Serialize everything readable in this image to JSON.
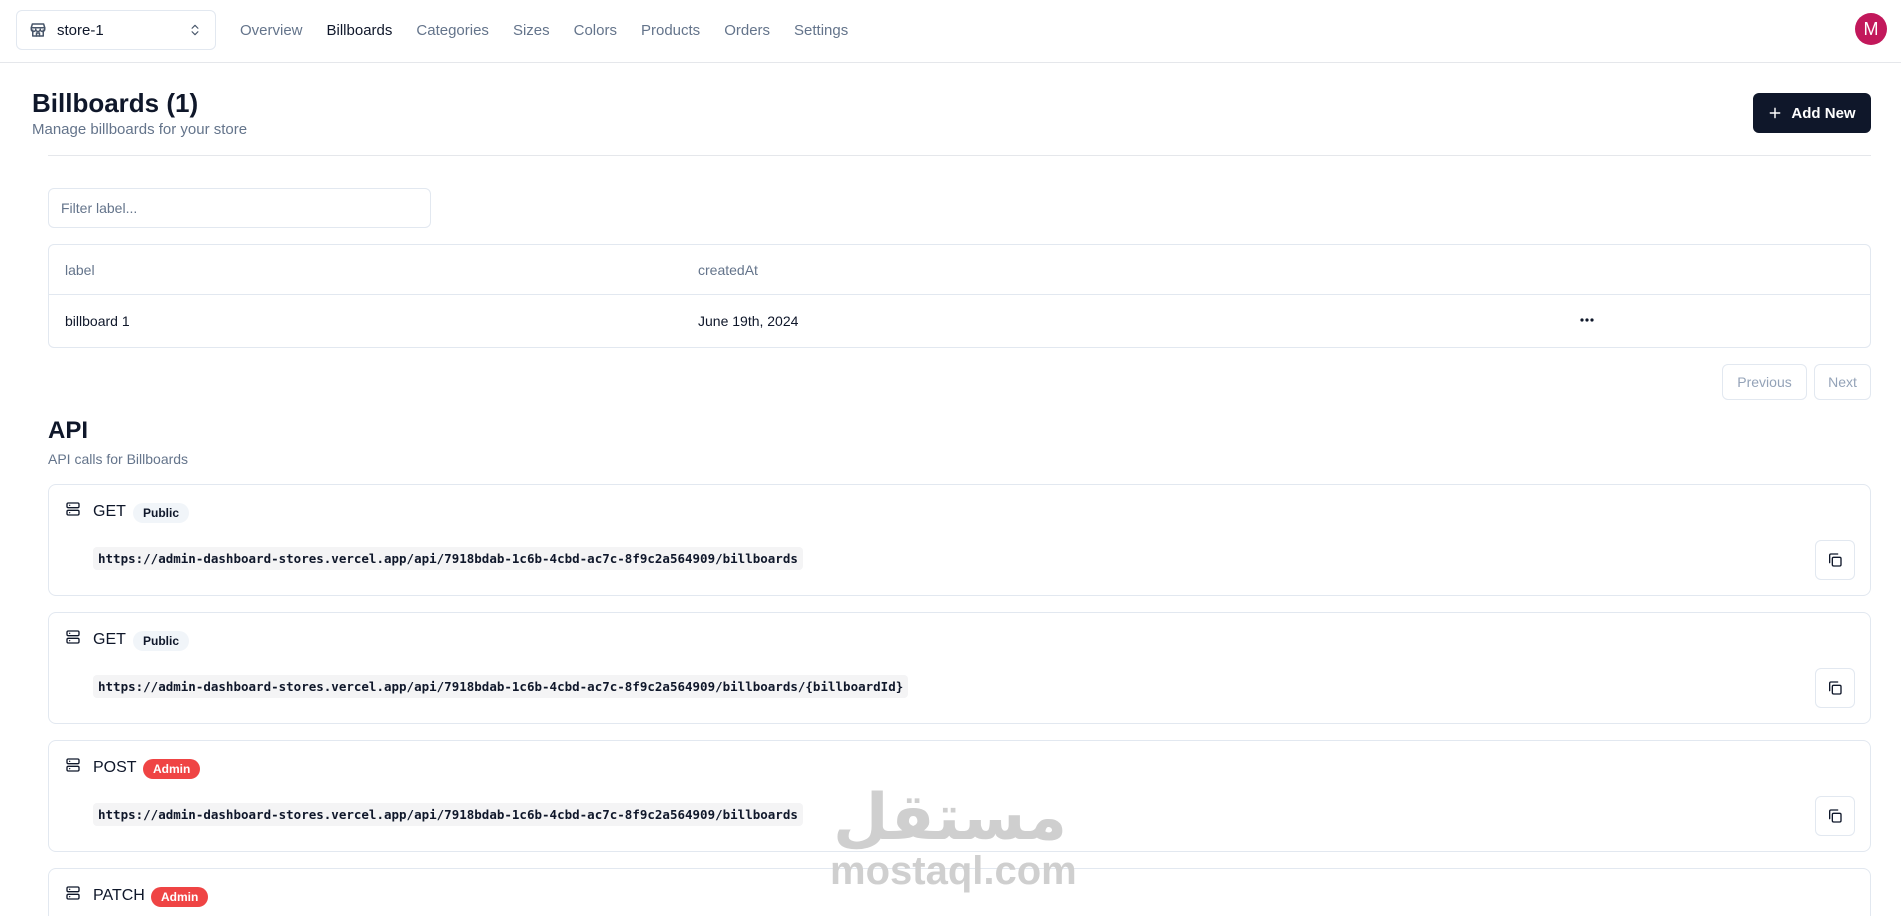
{
  "navbar": {
    "store": {
      "name": "store-1",
      "icon": "store-icon",
      "chevron_icon": "chevrons-up-down-icon"
    },
    "links": [
      {
        "label": "Overview",
        "active": false
      },
      {
        "label": "Billboards",
        "active": true
      },
      {
        "label": "Categories",
        "active": false
      },
      {
        "label": "Sizes",
        "active": false
      },
      {
        "label": "Colors",
        "active": false
      },
      {
        "label": "Products",
        "active": false
      },
      {
        "label": "Orders",
        "active": false
      },
      {
        "label": "Settings",
        "active": false
      }
    ],
    "avatar": {
      "initial": "M",
      "color": "#c2185b"
    }
  },
  "header": {
    "title": "Billboards (1)",
    "subtitle": "Manage billboards for your store",
    "add_button": {
      "label": "Add New",
      "icon": "plus-icon"
    }
  },
  "filter": {
    "placeholder": "Filter label...",
    "value": ""
  },
  "table": {
    "columns": [
      "label",
      "createdAt"
    ],
    "rows": [
      {
        "label": "billboard 1",
        "createdAt": "June 19th, 2024",
        "actions_icon": "more-horizontal-icon"
      }
    ]
  },
  "pagination": {
    "previous": "Previous",
    "next": "Next"
  },
  "api": {
    "title": "API",
    "subtitle": "API calls for Billboards",
    "endpoints": [
      {
        "method": "GET",
        "badge": "Public",
        "url": "https://admin-dashboard-stores.vercel.app/api/7918bdab-1c6b-4cbd-ac7c-8f9c2a564909/billboards"
      },
      {
        "method": "GET",
        "badge": "Public",
        "url": "https://admin-dashboard-stores.vercel.app/api/7918bdab-1c6b-4cbd-ac7c-8f9c2a564909/billboards/{billboardId}"
      },
      {
        "method": "POST",
        "badge": "Admin",
        "url": "https://admin-dashboard-stores.vercel.app/api/7918bdab-1c6b-4cbd-ac7c-8f9c2a564909/billboards"
      },
      {
        "method": "PATCH",
        "badge": "Admin",
        "url": ""
      }
    ]
  },
  "watermark": {
    "arabic": "مستقل",
    "latin": "mostaql.com"
  },
  "colors": {
    "primary": "#0f172a",
    "muted": "#64748b",
    "admin_badge": "#ef4444",
    "border": "#e2e8f0"
  }
}
